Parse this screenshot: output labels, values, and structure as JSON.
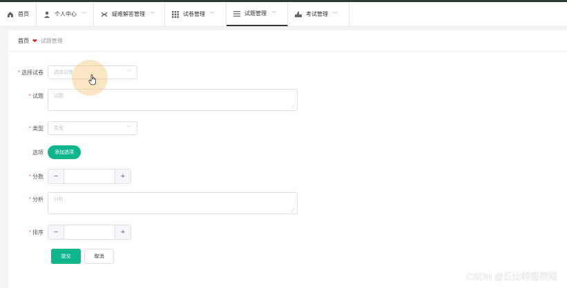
{
  "nav": {
    "items": [
      {
        "label": "首页",
        "icon": "home-icon",
        "dropdown": false
      },
      {
        "label": "个人中心",
        "icon": "user-icon",
        "dropdown": true
      },
      {
        "label": "疑难解答管理",
        "icon": "tools-icon",
        "dropdown": true
      },
      {
        "label": "试卷管理",
        "icon": "grid-icon",
        "dropdown": true
      },
      {
        "label": "试题管理",
        "icon": "list-icon",
        "dropdown": true,
        "active": true
      },
      {
        "label": "考试管理",
        "icon": "exam-icon",
        "dropdown": true
      }
    ]
  },
  "breadcrumb": {
    "home": "首页",
    "current": "试题管理"
  },
  "form": {
    "paper": {
      "label": "选择试卷",
      "placeholder": "选择试卷"
    },
    "question": {
      "label": "试题",
      "placeholder": "试题"
    },
    "type": {
      "label": "类型",
      "placeholder": "类型"
    },
    "options": {
      "label": "选项",
      "add_label": "添加选项"
    },
    "score": {
      "label": "分数",
      "value": ""
    },
    "analysis": {
      "label": "分析",
      "placeholder": "分析"
    },
    "order": {
      "label": "排序",
      "value": ""
    }
  },
  "actions": {
    "submit": "提交",
    "cancel": "取消"
  },
  "watermark": "CSDN @丘比特惩罚陆",
  "colors": {
    "accent": "#0fb58c",
    "required": "#f56c6c",
    "heart": "#e0262b"
  }
}
